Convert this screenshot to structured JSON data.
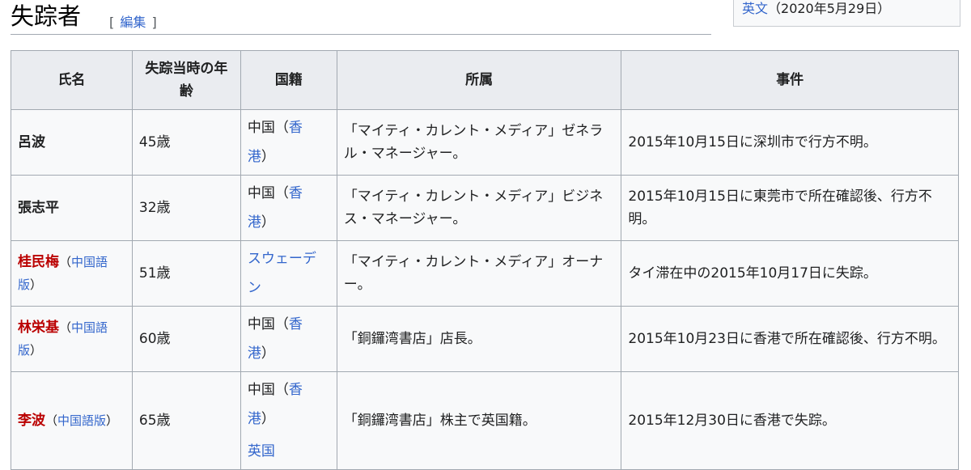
{
  "heading": {
    "title": "失踪者",
    "edit_open": "[",
    "edit_label": "編集",
    "edit_close": "]"
  },
  "infobox": {
    "link": "英文",
    "date": "（2020年5月29日）"
  },
  "table": {
    "headers": [
      "氏名",
      "失踪当時の年齢",
      "国籍",
      "所属",
      "事件"
    ],
    "rows": [
      {
        "name": "呂波",
        "name_red": false,
        "name_sub": "",
        "age": "45歳",
        "nat_main": "中国",
        "nat_open": "（",
        "nat_link": "香港",
        "nat_close": "）",
        "nat_extra": "",
        "affil": "「マイティ・カレント・メディア」ゼネラル・マネージャー。",
        "event": "2015年10月15日に深圳市で行方不明。"
      },
      {
        "name": "張志平",
        "name_red": false,
        "name_sub": "",
        "age": "32歳",
        "nat_main": "中国",
        "nat_open": "（",
        "nat_link": "香港",
        "nat_close": "）",
        "nat_extra": "",
        "affil": "「マイティ・カレント・メディア」ビジネス・マネージャー。",
        "event": "2015年10月15日に東莞市で所在確認後、行方不明。"
      },
      {
        "name": "桂民梅",
        "name_red": true,
        "name_sub": "中国語版",
        "age": "51歳",
        "nat_main": "",
        "nat_open": "",
        "nat_link": "スウェーデン",
        "nat_close": "",
        "nat_extra": "",
        "affil": "「マイティ・カレント・メディア」オーナー。",
        "event": "タイ滞在中の2015年10月17日に失踪。"
      },
      {
        "name": "林栄基",
        "name_red": true,
        "name_sub": "中国語版",
        "age": "60歳",
        "nat_main": "中国",
        "nat_open": "（",
        "nat_link": "香港",
        "nat_close": "）",
        "nat_extra": "",
        "affil": "「銅鑼湾書店」店長。",
        "event": "2015年10月23日に香港で所在確認後、行方不明。"
      },
      {
        "name": "李波",
        "name_red": true,
        "name_sub": "中国語版",
        "age": "65歳",
        "nat_main": "中国",
        "nat_open": "（",
        "nat_link": "香港",
        "nat_close": "）",
        "nat_extra": "英国",
        "affil": "「銅鑼湾書店」株主で英国籍。",
        "event": "2015年12月30日に香港で失踪。"
      }
    ]
  },
  "colors": {
    "link": "#3366cc",
    "redlink": "#ba0000",
    "header_bg": "#eaecf0",
    "border": "#a2a9b1"
  }
}
